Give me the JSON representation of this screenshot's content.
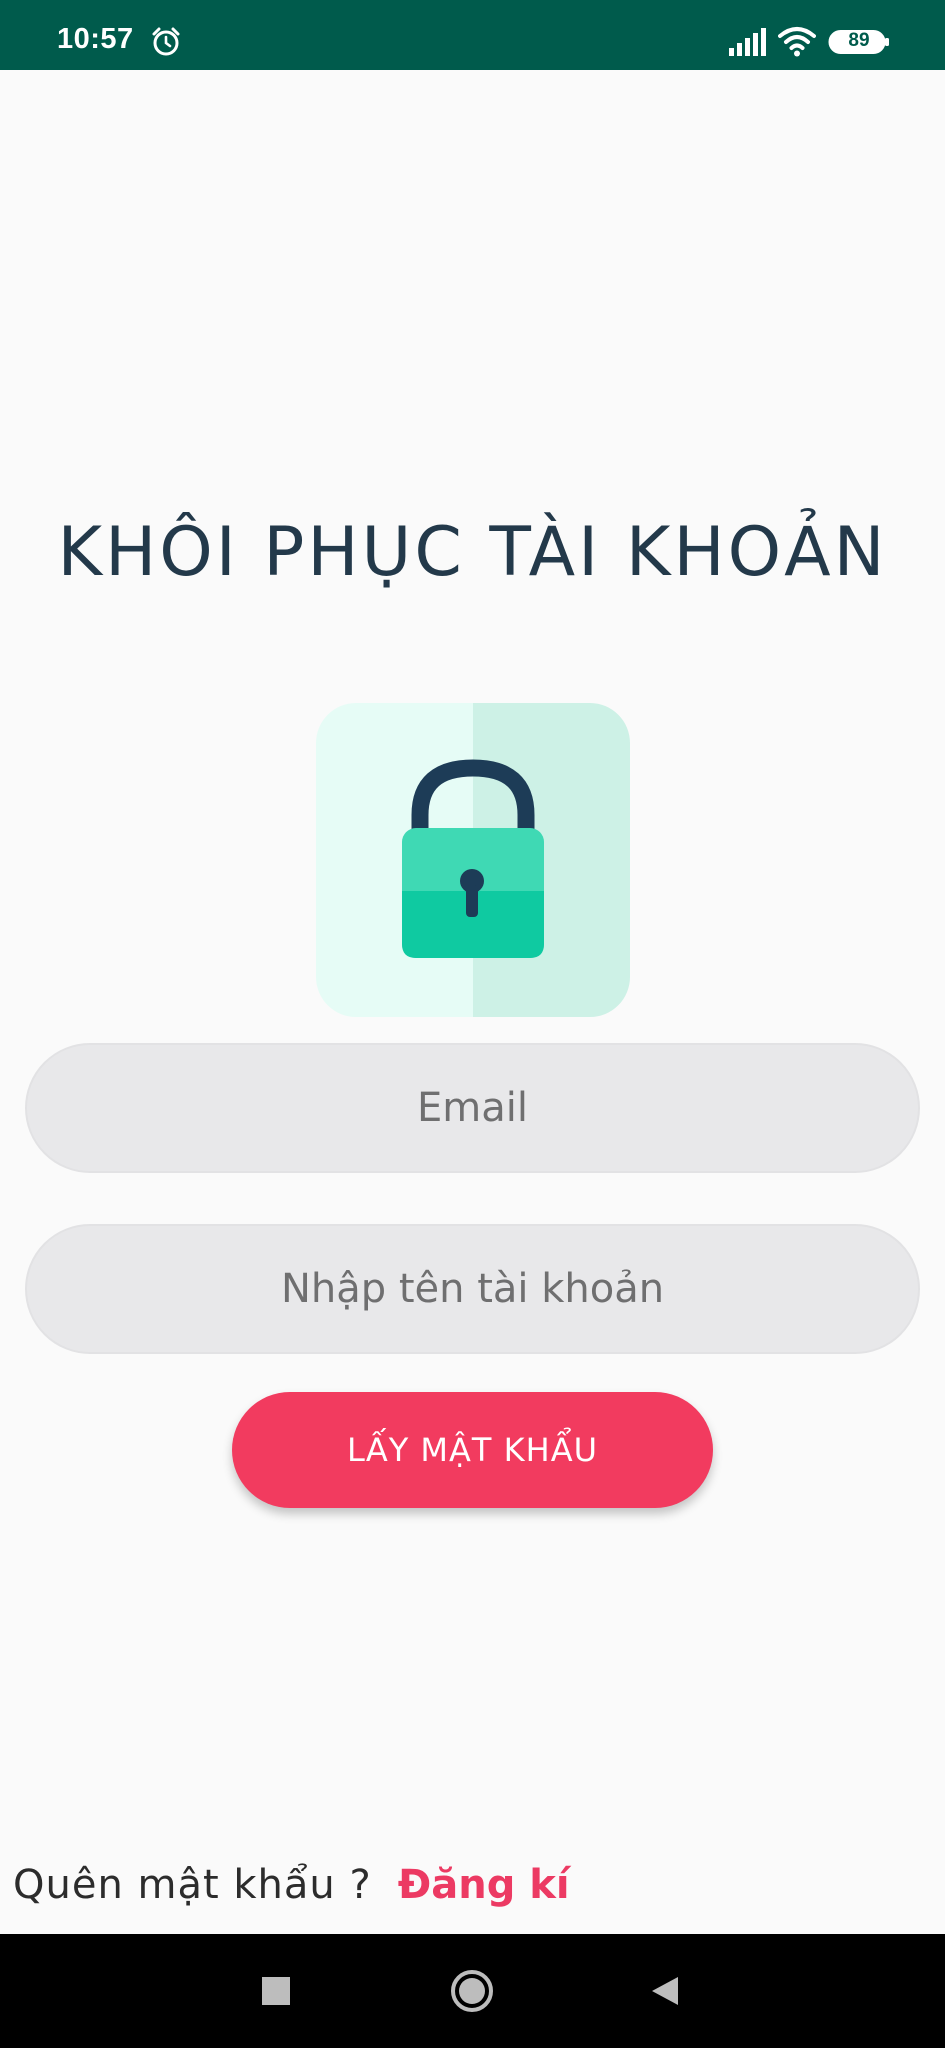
{
  "status_bar": {
    "time": "10:57",
    "battery_level": "89",
    "icons": [
      "alarm-icon",
      "signal-icon",
      "wifi-icon",
      "battery-icon"
    ],
    "background_color": "#005b4c"
  },
  "page": {
    "title": "KHÔI PHỤC TÀI KHOẢN",
    "illustration": "lock-icon"
  },
  "form": {
    "email_placeholder": "Email",
    "username_placeholder": "Nhập tên tài khoản",
    "submit_label": "LẤY MẬT KHẨU"
  },
  "footer": {
    "forgot_text": "Quên mật khẩu ?",
    "register_link": "Đăng kí"
  },
  "nav_bar": {
    "buttons": [
      "recent-apps-icon",
      "home-icon",
      "back-icon"
    ]
  },
  "colors": {
    "title": "#23394a",
    "accent": "#f23b5f",
    "link": "#ec3a63",
    "input_bg": "#e8e8ea",
    "lock_body": "#3fd9b4",
    "lock_shackle": "#1d3c57"
  }
}
